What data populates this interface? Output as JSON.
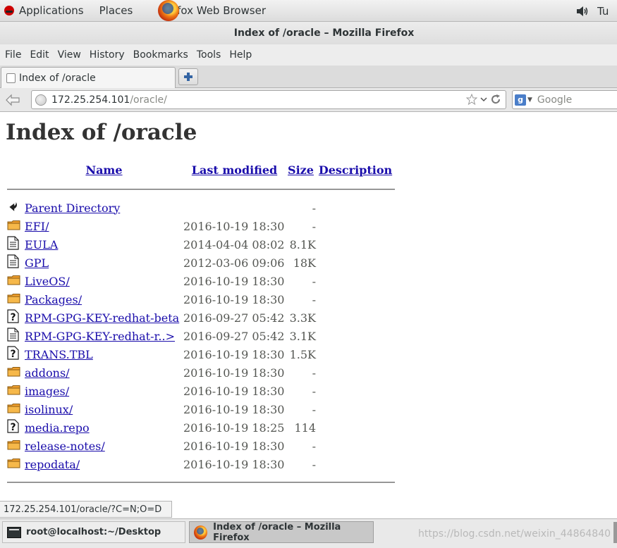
{
  "topbar": {
    "applications": "Applications",
    "places": "Places",
    "active_app": "Firefox Web Browser",
    "user_short": "Tu"
  },
  "window": {
    "title": "Index of /oracle – Mozilla Firefox"
  },
  "menu": [
    "File",
    "Edit",
    "View",
    "History",
    "Bookmarks",
    "Tools",
    "Help"
  ],
  "tab": {
    "label": "Index of /oracle"
  },
  "navbar": {
    "url_host": "172.25.254.101",
    "url_path": "/oracle/",
    "search_placeholder": "Google"
  },
  "page": {
    "title": "Index of /oracle",
    "columns": {
      "name": "Name",
      "last_modified": "Last modified",
      "size": "Size",
      "description": "Description"
    },
    "rows": [
      {
        "icon": "back",
        "name": "Parent Directory",
        "modified": "",
        "size": "-"
      },
      {
        "icon": "folder",
        "name": "EFI/",
        "modified": "2016-10-19 18:30",
        "size": "-"
      },
      {
        "icon": "text",
        "name": "EULA",
        "modified": "2014-04-04 08:02",
        "size": "8.1K"
      },
      {
        "icon": "text",
        "name": "GPL",
        "modified": "2012-03-06 09:06",
        "size": "18K"
      },
      {
        "icon": "folder",
        "name": "LiveOS/",
        "modified": "2016-10-19 18:30",
        "size": "-"
      },
      {
        "icon": "folder",
        "name": "Packages/",
        "modified": "2016-10-19 18:30",
        "size": "-"
      },
      {
        "icon": "unknown",
        "name": "RPM-GPG-KEY-redhat-beta",
        "modified": "2016-09-27 05:42",
        "size": "3.3K"
      },
      {
        "icon": "text",
        "name": "RPM-GPG-KEY-redhat-r..>",
        "modified": "2016-09-27 05:42",
        "size": "3.1K"
      },
      {
        "icon": "unknown",
        "name": "TRANS.TBL",
        "modified": "2016-10-19 18:30",
        "size": "1.5K"
      },
      {
        "icon": "folder",
        "name": "addons/",
        "modified": "2016-10-19 18:30",
        "size": "-"
      },
      {
        "icon": "folder",
        "name": "images/",
        "modified": "2016-10-19 18:30",
        "size": "-"
      },
      {
        "icon": "folder",
        "name": "isolinux/",
        "modified": "2016-10-19 18:30",
        "size": "-"
      },
      {
        "icon": "unknown",
        "name": "media.repo",
        "modified": "2016-10-19 18:25",
        "size": "114"
      },
      {
        "icon": "folder",
        "name": "release-notes/",
        "modified": "2016-10-19 18:30",
        "size": "-"
      },
      {
        "icon": "folder",
        "name": "repodata/",
        "modified": "2016-10-19 18:30",
        "size": "-"
      }
    ]
  },
  "statusbar": {
    "text": "172.25.254.101/oracle/?C=N;O=D"
  },
  "taskbar": {
    "terminal": "root@localhost:~/Desktop",
    "firefox": "Index of /oracle – Mozilla Firefox",
    "watermark": "https://blog.csdn.net/weixin_44864840"
  },
  "colors": {
    "link": "#1a0dab",
    "folder": "#f0a030",
    "text": "#2e3436"
  }
}
